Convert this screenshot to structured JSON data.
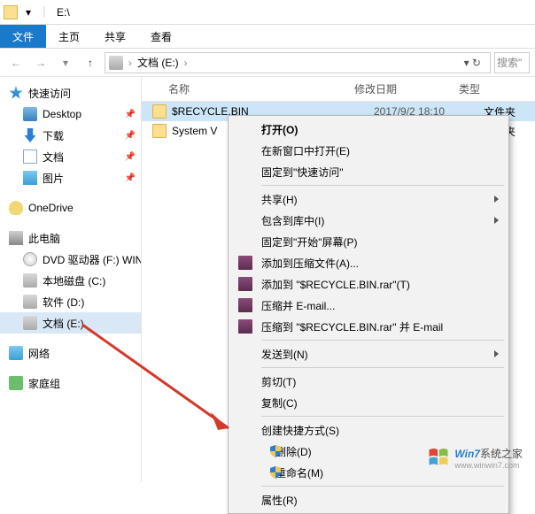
{
  "titlebar": {
    "path": "E:\\"
  },
  "ribbon": {
    "file": "文件",
    "home": "主页",
    "share": "共享",
    "view": "查看"
  },
  "breadcrumb": {
    "item0": "文档 (E:)",
    "search_placeholder": "搜索\""
  },
  "sidebar": {
    "quick": "快速访问",
    "desktop": "Desktop",
    "downloads": "下载",
    "docs": "文档",
    "pics": "图片",
    "onedrive": "OneDrive",
    "thispc": "此电脑",
    "dvd": "DVD 驱动器 (F:) WIN",
    "cdrive": "本地磁盘 (C:)",
    "ddrive": "软件 (D:)",
    "edrive": "文档 (E:)",
    "network": "网络",
    "homegroup": "家庭组"
  },
  "columns": {
    "name": "名称",
    "date": "修改日期",
    "type": "类型"
  },
  "files": {
    "row0": {
      "name": "$RECYCLE.BIN",
      "date": "2017/9/2 18:10",
      "type": "文件夹"
    },
    "row1": {
      "name": "System V",
      "date": "",
      "type": "文件夹"
    }
  },
  "contextmenu": {
    "open": "打开(O)",
    "newwin": "在新窗口中打开(E)",
    "pinquick": "固定到\"快速访问\"",
    "share": "共享(H)",
    "include": "包含到库中(I)",
    "pinstart": "固定到\"开始\"屏幕(P)",
    "addzip": "添加到压缩文件(A)...",
    "addzipname": "添加到 \"$RECYCLE.BIN.rar\"(T)",
    "zipemail": "压缩并 E-mail...",
    "zipemailname": "压缩到 \"$RECYCLE.BIN.rar\" 并 E-mail",
    "sendto": "发送到(N)",
    "cut": "剪切(T)",
    "copy": "复制(C)",
    "shortcut": "创建快捷方式(S)",
    "delete": "删除(D)",
    "rename": "重命名(M)",
    "props": "属性(R)"
  },
  "watermark": {
    "brand": "Win7",
    "suffix": "系统之家",
    "url": "www.winwin7.com"
  }
}
